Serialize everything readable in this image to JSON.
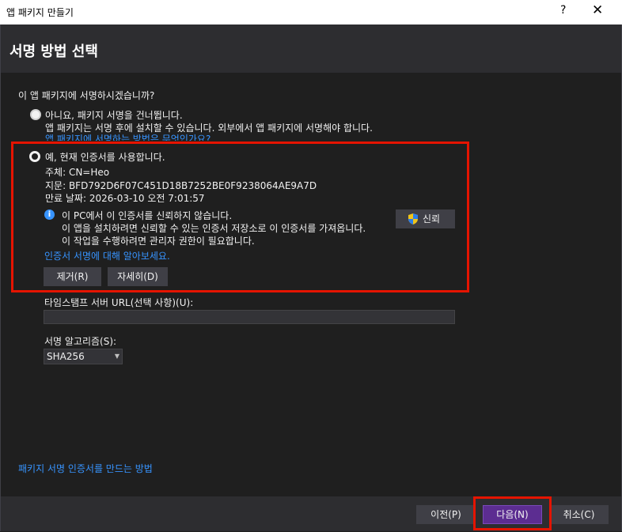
{
  "window": {
    "title": "앱 패키지 만들기",
    "help_label": "?",
    "close_label": "✕"
  },
  "header": {
    "title": "서명 방법 선택"
  },
  "question": "이 앱 패키지에 서명하시겠습니까?",
  "option_skip": {
    "label": "아니요, 패키지 서명을 건너뜁니다.",
    "description": "앱 패키지는 서명 후에 설치할 수 있습니다. 외부에서 앱 패키지에 서명해야 합니다.",
    "link": "앱 패키지에 서명하는 방법은 무엇인가요?",
    "selected": false
  },
  "option_current": {
    "label": "예, 현재 인증서를 사용합니다.",
    "selected": true,
    "subject": "주체: CN=Heo",
    "thumbprint": "지문: BFD792D6F07C451D18B7252BE0F9238064AE9A7D",
    "expiry": "만료 날짜: 2026-03-10 오전 7:01:57",
    "warning_lines": [
      "이 PC에서 이 인증서를 신뢰하지 않습니다.",
      "이 앱을 설치하려면 신뢰할 수 있는 인증서 저장소로 이 인증서를 가져옵니다.",
      "이 작업을 수행하려면 관리자 권한이 필요합니다."
    ],
    "trust_button": "신뢰",
    "learn_link": "인증서 서명에 대해 알아보세요.",
    "remove_button": "제거(R)",
    "details_button": "자세히(D)"
  },
  "timestamp": {
    "label": "타임스탬프 서버 URL(선택 사항)(U):",
    "value": ""
  },
  "algorithm": {
    "label": "서명 알고리즘(S):",
    "selected": "SHA256"
  },
  "bottom_link": "패키지 서명 인증서를 만드는 방법",
  "footer": {
    "prev_button": "이전(P)",
    "next_button": "다음(N)",
    "cancel_button": "취소(C)"
  },
  "colors": {
    "accent": "#5c2d91",
    "highlight": "#e51400",
    "link": "#3794ff",
    "background": "#1f1f1f"
  }
}
